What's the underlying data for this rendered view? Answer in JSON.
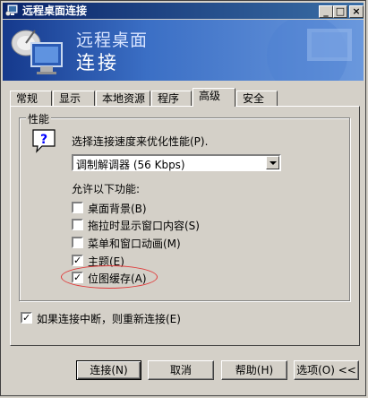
{
  "window": {
    "title": "远程桌面连接"
  },
  "titlebar_buttons": {
    "minimize": "_",
    "maximize": "□",
    "close": "×"
  },
  "banner": {
    "line1": "远程桌面",
    "line2": "连接"
  },
  "tabs": [
    {
      "label": "常规"
    },
    {
      "label": "显示"
    },
    {
      "label": "本地资源"
    },
    {
      "label": "程序"
    },
    {
      "label": "高级"
    },
    {
      "label": "安全"
    }
  ],
  "active_tab": "高级",
  "performance": {
    "group_title": "性能",
    "prompt": "选择连接速度来优化性能(P).",
    "speed_select": {
      "selected": "调制解调器 (56 Kbps)"
    },
    "allow_label": "允许以下功能:",
    "options": [
      {
        "label": "桌面背景(B)",
        "checked": false
      },
      {
        "label": "拖拉时显示窗口内容(S)",
        "checked": false
      },
      {
        "label": "菜单和窗口动画(M)",
        "checked": false
      },
      {
        "label": "主题(E)",
        "checked": true
      },
      {
        "label": "位图缓存(A)",
        "checked": true
      }
    ]
  },
  "reconnect": {
    "label": "如果连接中断，则重新连接(E)",
    "checked": true
  },
  "buttons": {
    "connect": "连接(N)",
    "cancel": "取消",
    "help": "帮助(H)",
    "options": "选项(O) <<"
  },
  "colors": {
    "titlebar_start": "#0a246a",
    "titlebar_end": "#3a6ea5",
    "highlight_ring": "#e03a3a"
  }
}
